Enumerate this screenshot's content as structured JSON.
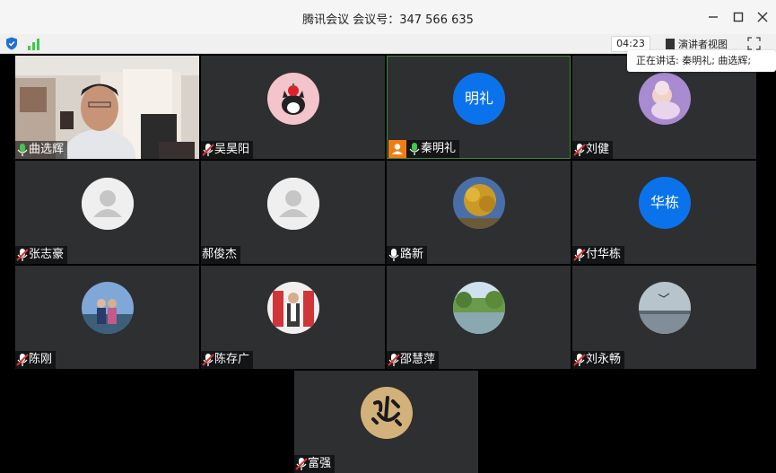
{
  "window": {
    "title": "腾讯会议 会议号：347 566 635",
    "timer": "04:23",
    "view_button": "演讲者视图"
  },
  "speaking": {
    "text": "正在讲话: 秦明礼; 曲选辉;"
  },
  "participants": [
    {
      "name": "曲选辉",
      "mic": "on",
      "avatar": "video"
    },
    {
      "name": "吴昊阳",
      "mic": "muted",
      "avatar": "cat-photo"
    },
    {
      "name": "秦明礼",
      "mic": "on",
      "avatar": "text",
      "avatar_text": "明礼",
      "host": true
    },
    {
      "name": "刘健",
      "mic": "muted",
      "avatar": "baby-photo"
    },
    {
      "name": "张志豪",
      "mic": "muted",
      "avatar": "default"
    },
    {
      "name": "郝俊杰",
      "mic": "none",
      "avatar": "default"
    },
    {
      "name": "路新",
      "mic": "off",
      "avatar": "tree-photo"
    },
    {
      "name": "付华栋",
      "mic": "muted",
      "avatar": "text",
      "avatar_text": "华栋"
    },
    {
      "name": "陈刚",
      "mic": "muted",
      "avatar": "couple-photo"
    },
    {
      "name": "陈存广",
      "mic": "muted",
      "avatar": "person-photo"
    },
    {
      "name": "邵慧萍",
      "mic": "muted",
      "avatar": "park-photo"
    },
    {
      "name": "刘永畅",
      "mic": "muted",
      "avatar": "lake-photo"
    },
    {
      "name": "富强",
      "mic": "muted",
      "avatar": "calligraphy-photo"
    }
  ],
  "colors": {
    "tile_bg": "#2e2f31",
    "accent_blue": "#0a73eb",
    "mic_green": "#3ec94b",
    "muted_red": "#e03131",
    "host_orange": "#f07c16"
  }
}
